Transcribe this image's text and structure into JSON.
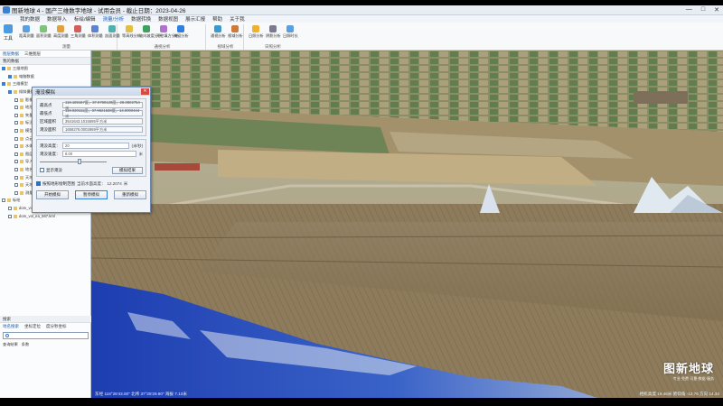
{
  "window": {
    "title": "图新地球 4 - 国产三维数字地球 - 试用会员 - 截止日期：2023-04-26",
    "controls": [
      "—",
      "□",
      "✕"
    ]
  },
  "menu": [
    "我的数据",
    "数据导入",
    "标绘/编辑",
    "测量/分析",
    "数据转换",
    "数据视图",
    "展示汇报",
    "帮助",
    "关于我"
  ],
  "menu_active_index": 3,
  "ribbon": {
    "big_button": "工具",
    "groups": [
      {
        "label": "测量",
        "items": [
          "距离测量",
          "面积测量",
          "高度测量",
          "三角测量",
          "体积测量",
          "剖面测量"
        ]
      },
      {
        "label": "通视分析",
        "items": [
          "等高线分析",
          "坡向坡度分析",
          "开挖填方分析",
          "淹没分析"
        ]
      },
      {
        "label": "视域分析",
        "items": [
          "通视分析",
          "视域分析"
        ]
      },
      {
        "label": "日照分析",
        "items": [
          "日照分析",
          "阴影分析",
          "日照时长"
        ]
      }
    ]
  },
  "left_panel": {
    "tabs": [
      "图层数据",
      "三维图层"
    ],
    "layers_header": "我的数据",
    "tree": [
      {
        "label": "三维地图",
        "checked": true,
        "level": 0
      },
      {
        "label": "电脑数据",
        "checked": true,
        "level": 1
      },
      {
        "label": "三维模型",
        "checked": true,
        "level": 0
      },
      {
        "label": "倾斜摄影",
        "checked": true,
        "level": 1
      },
      {
        "label": "影像数据",
        "checked": false,
        "level": 2
      },
      {
        "label": "地形数据",
        "checked": false,
        "level": 2
      },
      {
        "label": "矢量数据",
        "checked": false,
        "level": 2
      },
      {
        "label": "标注数据",
        "checked": false,
        "level": 2
      },
      {
        "label": "模型数据",
        "checked": false,
        "level": 2
      },
      {
        "label": "点云数据",
        "checked": false,
        "level": 2
      },
      {
        "label": "水体数据",
        "checked": false,
        "level": 2
      },
      {
        "label": "图层组",
        "checked": false,
        "level": 2
      },
      {
        "label": "导入数据",
        "checked": false,
        "level": 2
      },
      {
        "label": "地名数据",
        "checked": false,
        "level": 2
      },
      {
        "label": "天地图影像",
        "checked": false,
        "level": 2
      },
      {
        "label": "天地图注记",
        "checked": false,
        "level": 2
      },
      {
        "label": "测量数据",
        "checked": false,
        "level": 2
      },
      {
        "label": "标绘",
        "checked": false,
        "level": 0
      },
      {
        "label": "dom_vol_ea_567.tif",
        "checked": false,
        "level": 1
      },
      {
        "label": "dom_vol_ea_567.kml",
        "checked": false,
        "level": 1
      }
    ],
    "search_header": "搜索",
    "search_tabs": [
      "地名搜索",
      "坐标定位",
      "度分秒坐标"
    ],
    "search_placeholder": "",
    "result_row": [
      "查询结果",
      "条数"
    ]
  },
  "dialog": {
    "title": "淹没模拟",
    "close": "✕",
    "fields": [
      {
        "label": "最高点",
        "value": "118.189167度，37.9789128度，28.0802754米"
      },
      {
        "label": "最低点",
        "value": "118.020111度，37.9621538度，14.0000444米"
      },
      {
        "label": "区域面积",
        "value": "3541643.1015695平方米"
      },
      {
        "label": "淹没面积",
        "value": "1658276.0002869平方米"
      }
    ],
    "flood_height_label": "淹没高度：",
    "flood_height_value": "20",
    "flood_height_unit": "(米/秒)",
    "speed_label": "淹没速度：",
    "speed_value": "8.00",
    "speed_unit": "米",
    "slider_fraction": 0.6,
    "check_show_label": "显示淹没",
    "sim_result_button": "模拟结果",
    "terrain_check_label": "按照地形绘制范围",
    "terrain_value": "当前水面高度：",
    "terrain_num": "12.2074",
    "terrain_unit": "米",
    "buttons": [
      "开始模拟",
      "暂停模拟",
      "重新模拟"
    ]
  },
  "scene": {
    "watermark_title": "图新地球",
    "watermark_sub": "专业·免费·可靠·数据·服务"
  },
  "status": {
    "left": "东经 118°28'43.00\" 北纬 37°25'29.90\" 海拔 7.13米",
    "right": "相机高度 19.46米 俯仰角 -12.76 方向 14.34"
  },
  "colors": {
    "accent": "#1a5fb4",
    "water": "#2a4ec0",
    "field": "#8b7a57"
  }
}
